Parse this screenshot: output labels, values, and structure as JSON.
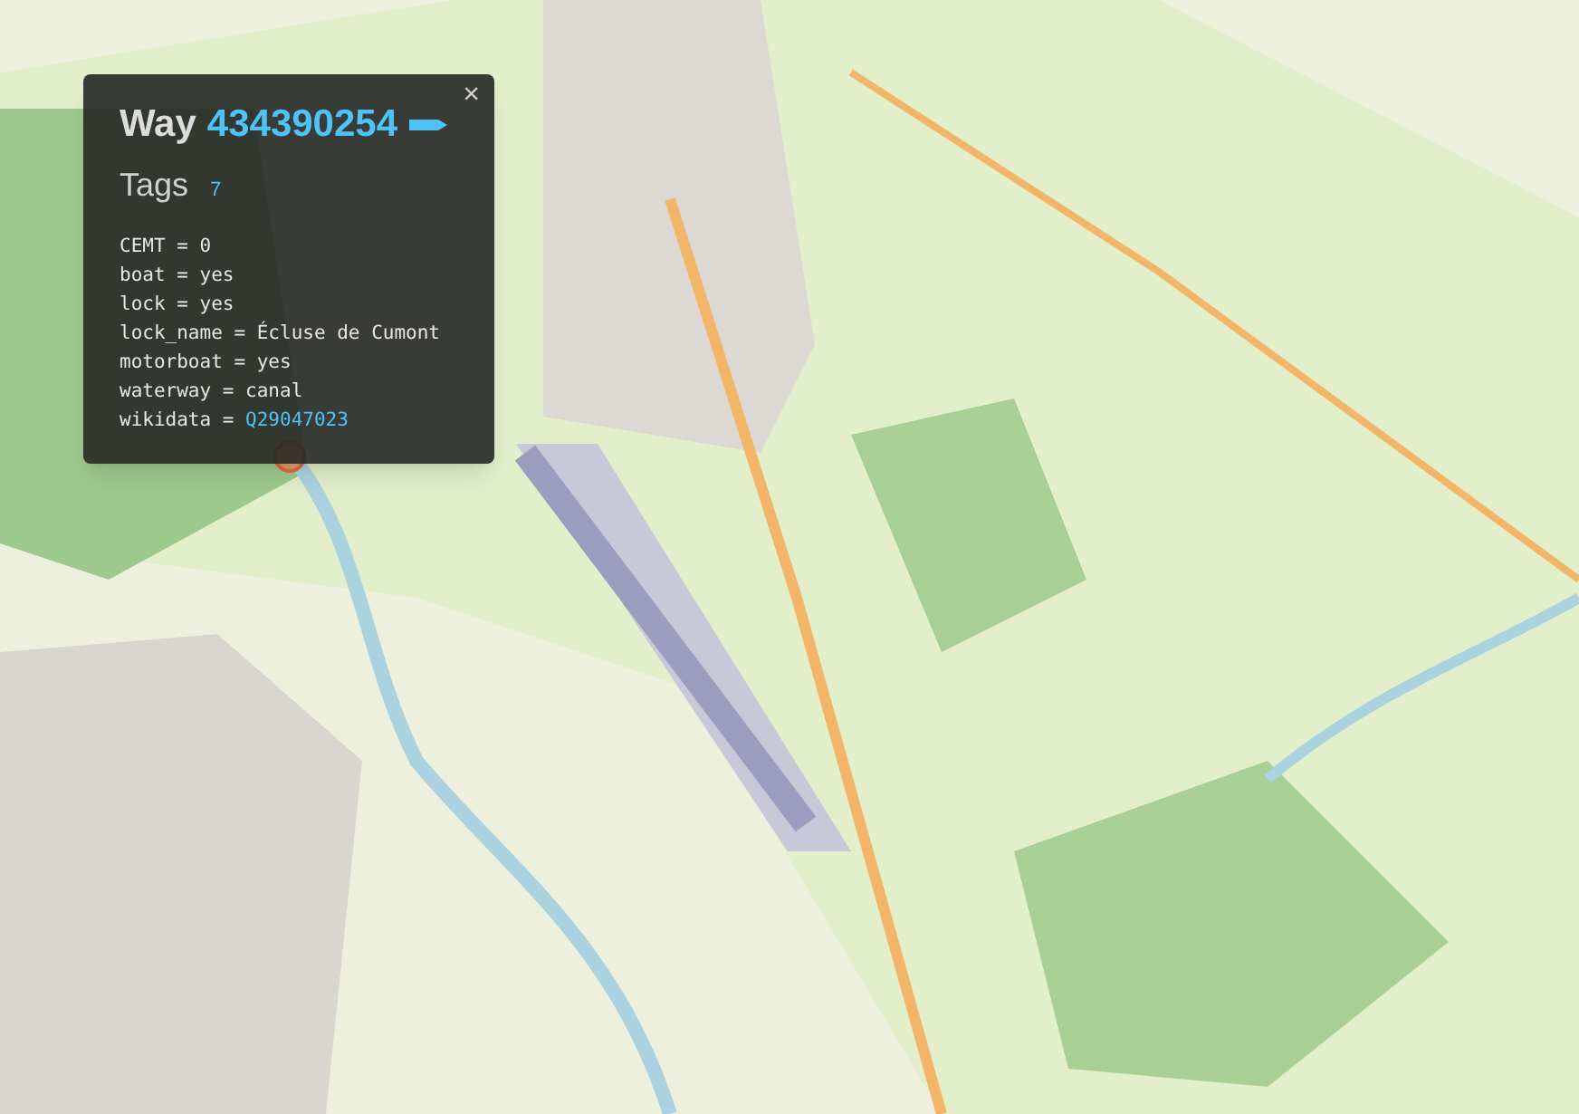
{
  "popup": {
    "type_label": "Way",
    "id": "434390254",
    "tags_heading": "Tags",
    "tag_count": "7",
    "close": "×",
    "tags": [
      {
        "kind": "plain",
        "key": "CEMT",
        "separator": "=",
        "value": "0"
      },
      {
        "kind": "plain",
        "key": "boat",
        "separator": "=",
        "value": "yes"
      },
      {
        "kind": "plain",
        "key": "lock",
        "separator": "=",
        "value": "yes"
      },
      {
        "kind": "plain",
        "key": "lock_name",
        "separator": "=",
        "value": "Écluse de Cumont"
      },
      {
        "kind": "plain",
        "key": "motorboat",
        "separator": "=",
        "value": "yes"
      },
      {
        "kind": "plain",
        "key": "waterway",
        "separator": "=",
        "value": "canal"
      },
      {
        "kind": "link",
        "key": "wikidata",
        "separator": "=",
        "value": "Q29047023"
      }
    ]
  }
}
